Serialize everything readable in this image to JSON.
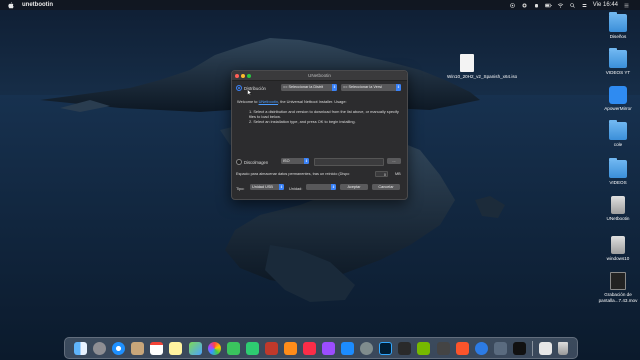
{
  "menubar": {
    "app_name": "unetbootin",
    "clock": "Vie 16:44"
  },
  "desktop": {
    "file_iso": "Win10_20H2_v2_Spanish_x64.iso",
    "icons_right": [
      {
        "label": "Diseños",
        "kind": "folder"
      },
      {
        "label": "VIDEOS YT",
        "kind": "folder"
      },
      {
        "label": "ApowerMirror",
        "kind": "app"
      },
      {
        "label": "cole",
        "kind": "folder"
      },
      {
        "label": "VIDEOS",
        "kind": "folder"
      },
      {
        "label": "UNetbootin",
        "kind": "disk"
      },
      {
        "label": "windows10",
        "kind": "disk"
      },
      {
        "label": "Grabación de pantalla...7.43.mov",
        "kind": "doc"
      }
    ]
  },
  "window": {
    "title": "UNetbootin",
    "distribution_label": "Distribución",
    "distro_select": "== Seleccionar la Distrit",
    "version_select": "== Seleccionar la Versi",
    "welcome_prefix": "Welcome to ",
    "welcome_link": "UNetbootin",
    "welcome_suffix": ", the Universal Netboot Installer. Usage:",
    "step1": "1. Select a distribution and version to download from the list above, or manually specify files to load below.",
    "step2": "2. Select an installation type, and press OK to begin installing.",
    "diskimage_label": "Discolmagen",
    "diskimage_type": "ISO",
    "browse_label": "...",
    "persist_label": "Espacio para almacenar datos permanentes, tras un reinicio (Dispo",
    "persist_value": "0",
    "persist_unit": "MB",
    "type_label": "Tipo:",
    "type_value": "Unidad USB",
    "drive_label": "Unidad:",
    "drive_value": "",
    "ok_label": "Aceptar",
    "cancel_label": "Cancelar"
  },
  "colors": {
    "accent": "#3a82f7",
    "window_bg": "#2c2c2e"
  }
}
